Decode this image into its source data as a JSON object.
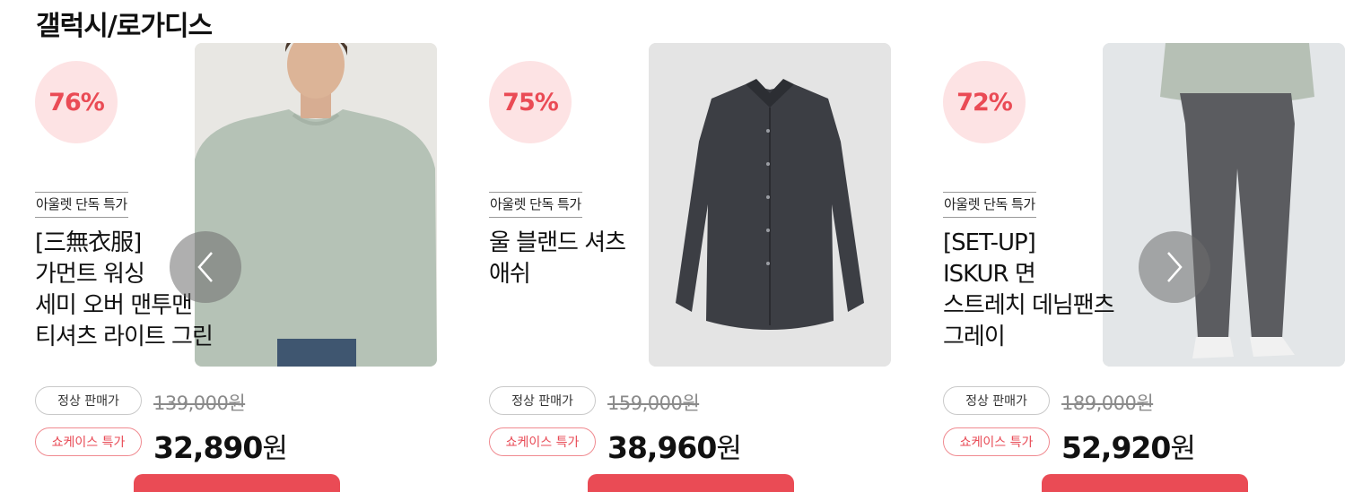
{
  "section": {
    "title": "갤럭시/로가디스"
  },
  "products": [
    {
      "discount": "76%",
      "tag": "아울렛 단독 특가",
      "name_lines": [
        "[三無衣服]",
        "가먼트 워싱",
        "세미 오버 맨투맨",
        "티셔츠 라이트 그린"
      ],
      "regular_label": "정상 판매가",
      "original_price": "139,000원",
      "showcase_label": "쇼케이스 특가",
      "sale_amount": "32,890",
      "sale_unit": "원",
      "image_icon": "sweatshirt-model-image"
    },
    {
      "discount": "75%",
      "tag": "아울렛 단독 특가",
      "name_lines": [
        "울 블랜드 셔츠",
        "애쉬"
      ],
      "regular_label": "정상 판매가",
      "original_price": "159,000원",
      "showcase_label": "쇼케이스 특가",
      "sale_amount": "38,960",
      "sale_unit": "원",
      "image_icon": "dress-shirt-image"
    },
    {
      "discount": "72%",
      "tag": "아울렛 단독 특가",
      "name_lines": [
        "[SET-UP]",
        "ISKUR 면",
        "스트레치 데님팬츠",
        "그레이"
      ],
      "regular_label": "정상 판매가",
      "original_price": "189,000원",
      "showcase_label": "쇼케이스 특가",
      "sale_amount": "52,920",
      "sale_unit": "원",
      "image_icon": "denim-pants-model-image"
    }
  ],
  "carousel": {
    "prev_icon": "chevron-left-icon",
    "next_icon": "chevron-right-icon"
  },
  "colors": {
    "accent": "#ea4b55",
    "badge_bg": "#fde3e4"
  }
}
